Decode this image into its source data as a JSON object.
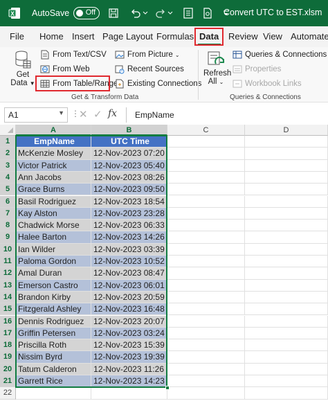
{
  "window": {
    "autosave_label": "AutoSave",
    "autosave_state": "Off",
    "file_title": "Convert UTC to EST.xlsm"
  },
  "menu": {
    "tabs": [
      "File",
      "Home",
      "Insert",
      "Page Layout",
      "Formulas",
      "Data",
      "Review",
      "View",
      "Automate"
    ],
    "active_tab": "Data"
  },
  "ribbon": {
    "get_data_label": "Get",
    "get_data_label2": "Data",
    "from_text_csv": "From Text/CSV",
    "from_web": "From Web",
    "from_table_range": "From Table/Range",
    "from_picture": "From Picture",
    "recent_sources": "Recent Sources",
    "existing_connections": "Existing Connections",
    "group_get_transform": "Get & Transform Data",
    "refresh_label": "Refresh",
    "refresh_label2": "All",
    "queries_connections": "Queries & Connections",
    "properties": "Properties",
    "workbook_links": "Workbook Links",
    "group_queries": "Queries & Connections"
  },
  "formula_bar": {
    "name_box": "A1",
    "fx": "fx",
    "content": "EmpName"
  },
  "grid": {
    "columns": [
      "A",
      "B",
      "C",
      "D"
    ],
    "header": [
      "EmpName",
      "UTC Time"
    ],
    "rows": [
      [
        "McKenzie Mosley",
        "12-Nov-2023 07:20"
      ],
      [
        "Victor Patrick",
        "12-Nov-2023 05:40"
      ],
      [
        "Ann Jacobs",
        "12-Nov-2023 08:26"
      ],
      [
        "Grace Burns",
        "12-Nov-2023 09:50"
      ],
      [
        "Basil Rodriguez",
        "12-Nov-2023 18:54"
      ],
      [
        "Kay Alston",
        "12-Nov-2023 23:28"
      ],
      [
        "Chadwick Morse",
        "12-Nov-2023 06:33"
      ],
      [
        "Halee Barton",
        "12-Nov-2023 14:26"
      ],
      [
        "Ian Wilder",
        "12-Nov-2023 03:39"
      ],
      [
        "Paloma Gordon",
        "12-Nov-2023 10:52"
      ],
      [
        "Amal Duran",
        "12-Nov-2023 08:47"
      ],
      [
        "Emerson Castro",
        "12-Nov-2023 06:01"
      ],
      [
        "Brandon Kirby",
        "12-Nov-2023 20:59"
      ],
      [
        "Fitzgerald Ashley",
        "12-Nov-2023 16:48"
      ],
      [
        "Dennis Rodriguez",
        "12-Nov-2023 20:07"
      ],
      [
        "Griffin Petersen",
        "12-Nov-2023 03:24"
      ],
      [
        "Priscilla Roth",
        "12-Nov-2023 15:39"
      ],
      [
        "Nissim Byrd",
        "12-Nov-2023 19:39"
      ],
      [
        "Tatum Calderon",
        "12-Nov-2023 11:26"
      ],
      [
        "Garrett Rice",
        "12-Nov-2023 14:23"
      ]
    ],
    "row_numbers": [
      "1",
      "2",
      "3",
      "4",
      "5",
      "6",
      "7",
      "8",
      "9",
      "10",
      "11",
      "12",
      "13",
      "14",
      "15",
      "16",
      "17",
      "18",
      "19",
      "20",
      "21",
      "22"
    ]
  },
  "colors": {
    "excel_green": "#0e6c3a",
    "table_header": "#4472c4",
    "table_band": "#d9e1f2",
    "highlight_red": "#e0282e"
  }
}
